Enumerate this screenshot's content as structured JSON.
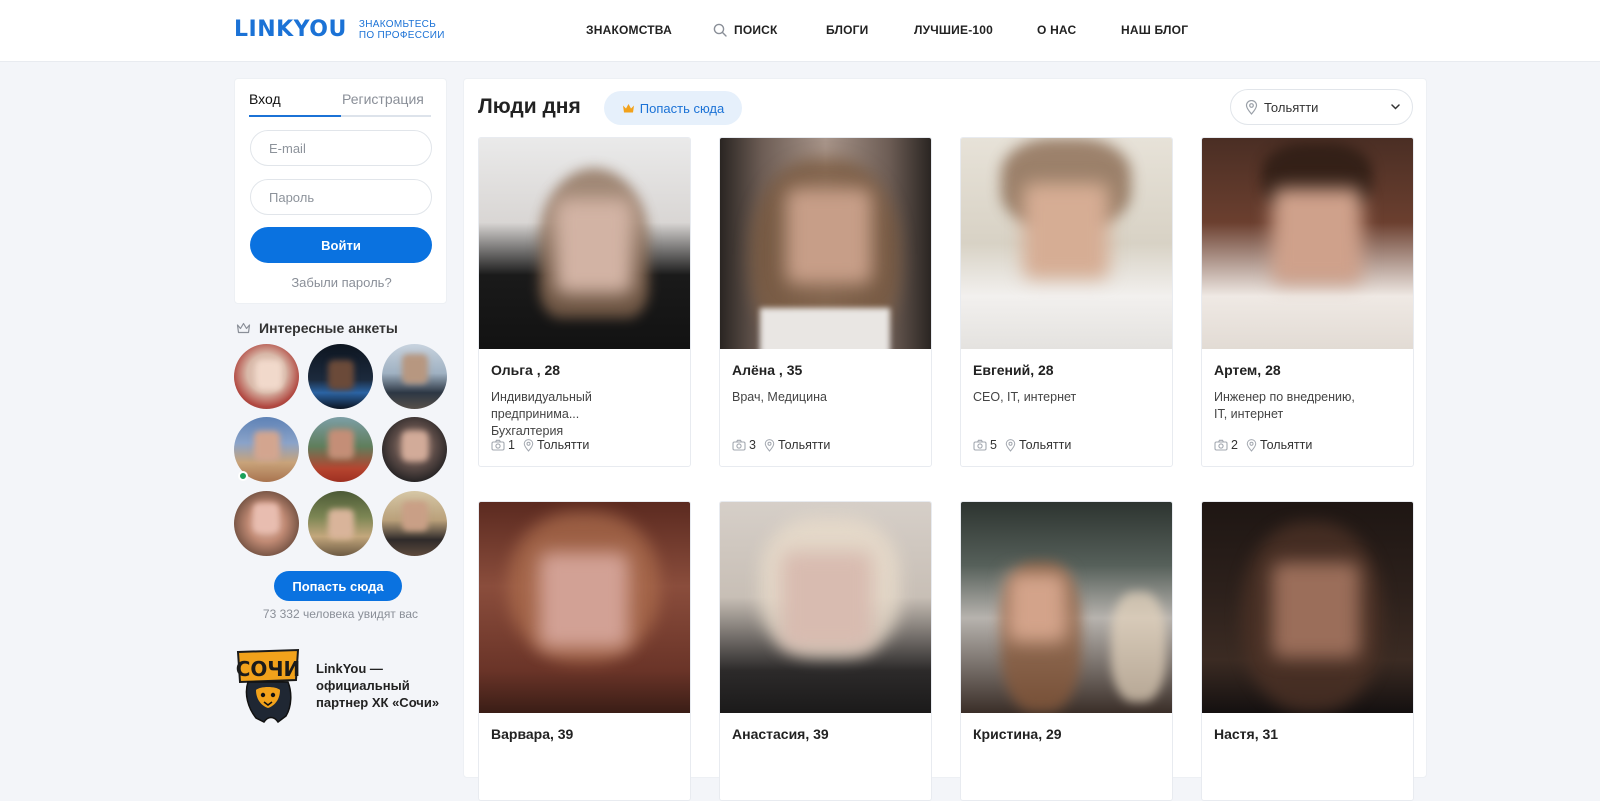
{
  "header": {
    "logo": "LINKYOU",
    "logo_sub_1": "ЗНАКОМЬТЕСЬ",
    "logo_sub_2": "ПО ПРОФЕССИИ",
    "nav": [
      "ЗНАКОМСТВА",
      "ПОИСК",
      "БЛОГИ",
      "ЛУЧШИЕ-100",
      "О НАС",
      "НАШ БЛОГ"
    ]
  },
  "login": {
    "tab_login": "Вход",
    "tab_register": "Регистрация",
    "email_placeholder": "E-mail",
    "password_placeholder": "Пароль",
    "submit": "Войти",
    "forgot": "Забыли пароль?"
  },
  "interesting": {
    "title": "Интересные анкеты",
    "cta": "Попасть сюда",
    "viewers": "73 332 человека увидят вас"
  },
  "partner": {
    "logo_text": "СОЧИ",
    "text": "LinkYou — официальный партнер ХК «Сочи»"
  },
  "main": {
    "title": "Люди дня",
    "promo": "Попасть сюда",
    "city": "Тольятти"
  },
  "profiles": [
    {
      "name": "Ольга , 28",
      "job": "Индивидуальный предпринима...\nБухгалтерия",
      "photos": "1",
      "city": "Тольятти"
    },
    {
      "name": "Алёна , 35",
      "job": "Врач, Медицина",
      "photos": "3",
      "city": "Тольятти"
    },
    {
      "name": "Евгений, 28",
      "job": "CEO, IT, интернет",
      "photos": "5",
      "city": "Тольятти"
    },
    {
      "name": "Артем, 28",
      "job": "Инженер по внедрению,\nIT, интернет",
      "photos": "2",
      "city": "Тольятти"
    },
    {
      "name": "Варвара, 39"
    },
    {
      "name": "Анастасия, 39"
    },
    {
      "name": "Кристина, 29"
    },
    {
      "name": "Настя, 31"
    }
  ],
  "colors": {
    "accent": "#0a72e0",
    "background": "#f3f5f9",
    "online": "#19a15b"
  }
}
